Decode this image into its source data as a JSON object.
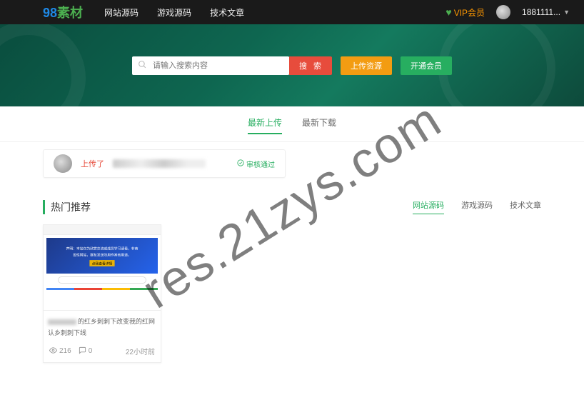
{
  "header": {
    "logo_left": "98",
    "logo_right": "素材",
    "nav": [
      {
        "label": "网站源码"
      },
      {
        "label": "游戏源码"
      },
      {
        "label": "技术文章"
      }
    ],
    "vip_label": "VIP会员",
    "username": "1881111..."
  },
  "hero": {
    "search_placeholder": "请输入搜索内容",
    "search_button": "搜 索",
    "upload_button": "上传资源",
    "member_button": "开通会员"
  },
  "tabs": [
    {
      "label": "最新上传",
      "active": true
    },
    {
      "label": "最新下载",
      "active": false
    }
  ],
  "activity": {
    "action": "上传了",
    "status": "审核通过"
  },
  "hot": {
    "title": "热门推荐",
    "tabs": [
      {
        "label": "网站源码",
        "active": true
      },
      {
        "label": "游戏源码",
        "active": false
      },
      {
        "label": "技术文章",
        "active": false
      }
    ],
    "card": {
      "thumb_banner_line1": "声明：本站仅为欣赏交流或成员学习请看，非商",
      "thumb_banner_line2": "盈性网站，群友发送勿用作其他用途。",
      "thumb_banner_btn": "点我查看详情",
      "title_suffix": "的红乡刺刺下改变我的红网认乡刺刺下线",
      "views": "216",
      "comments": "0",
      "time": "22小时前"
    }
  },
  "watermark": "res.21zys.com"
}
